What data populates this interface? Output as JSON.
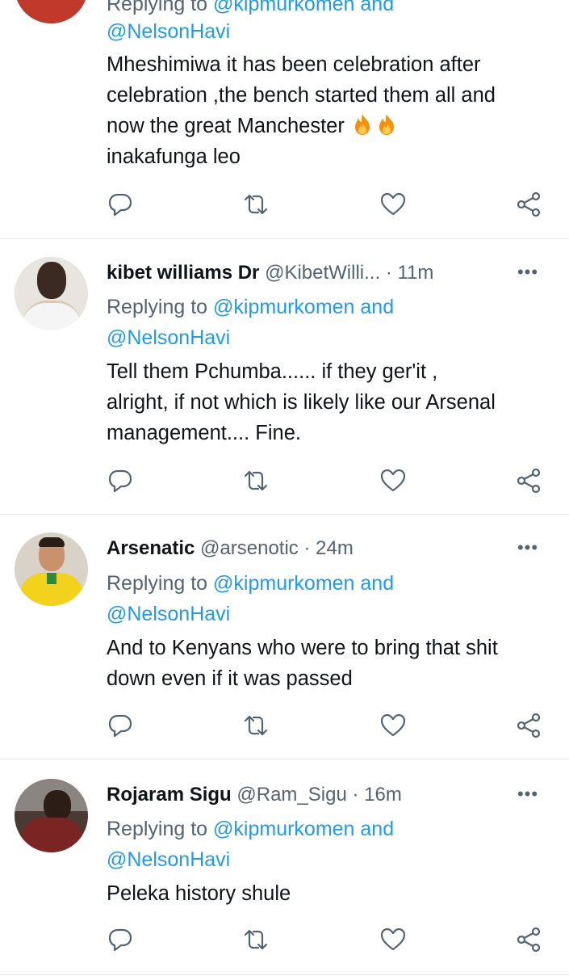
{
  "tweets": [
    {
      "reply_prefix": "Replying to",
      "mention_1": "@kipmurkomen and",
      "mention_2": "@NelsonHavi",
      "body_lines": [
        "Mheshimiwa it has been celebration after",
        "celebration ,the bench started them all and",
        "now the great Manchester",
        "inakafunga leo"
      ],
      "emoji": "fire-fire"
    },
    {
      "name": "kibet williams Dr",
      "handle": "@KibetWilli...",
      "time": "· 11m",
      "reply_prefix": "Replying to",
      "mention_1": "@kipmurkomen and",
      "mention_2": "@NelsonHavi",
      "body_lines": [
        "Tell them Pchumba...... if they ger'it ,",
        "alright, if not which is likely like our Arsenal",
        "management.... Fine."
      ]
    },
    {
      "name": "Arsenatic",
      "handle": "@arsenotic",
      "time": "· 24m",
      "reply_prefix": "Replying to",
      "mention_1": "@kipmurkomen and",
      "mention_2": "@NelsonHavi",
      "body_lines": [
        "And to Kenyans who were to bring that shit",
        "down even if it was passed"
      ]
    },
    {
      "name": "Rojaram Sigu",
      "handle": "@Ram_Sigu",
      "time": "· 16m",
      "reply_prefix": "Replying to",
      "mention_1": "@kipmurkomen and",
      "mention_2": "@NelsonHavi",
      "body_lines": [
        "Peleka history shule"
      ]
    }
  ],
  "more_glyph": "•••",
  "icons": {
    "reply": "reply-icon",
    "retweet": "retweet-icon",
    "like": "heart-icon",
    "share": "share-icon"
  },
  "colors": {
    "link": "#1d9bf0",
    "secondary": "#536471",
    "divider": "#e7e9ea"
  }
}
